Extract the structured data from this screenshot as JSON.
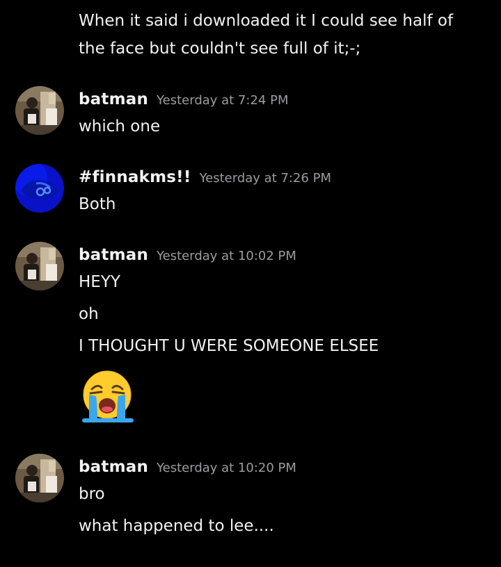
{
  "messages": [
    {
      "continuation": true,
      "lines": [
        "When it said i downloaded it I could see half of",
        "the face but couldn't see full of it;-;"
      ]
    },
    {
      "username": "batman",
      "timestamp": "Yesterday at 7:24 PM",
      "avatar": "batman-photo-avatar",
      "lines": [
        "which one"
      ]
    },
    {
      "username": "#finnakms!!",
      "timestamp": "Yesterday at 7:26 PM",
      "avatar": "blue-mask-avatar",
      "lines": [
        "Both"
      ]
    },
    {
      "username": "batman",
      "timestamp": "Yesterday at 10:02 PM",
      "avatar": "batman-photo-avatar",
      "lines": [
        "HEYY",
        "oh",
        "I THOUGHT U WERE SOMEONE ELSEE"
      ],
      "emoji": "loudly-crying-face-emoji"
    },
    {
      "username": "batman",
      "timestamp": "Yesterday at 10:20 PM",
      "avatar": "batman-photo-avatar",
      "lines": [
        "bro",
        "what happened to lee...."
      ]
    }
  ],
  "colors": {
    "background": "#000000",
    "text": "#f2f3f5",
    "timestamp": "#9b9ca3",
    "accent_blue": "#1a3cff"
  }
}
